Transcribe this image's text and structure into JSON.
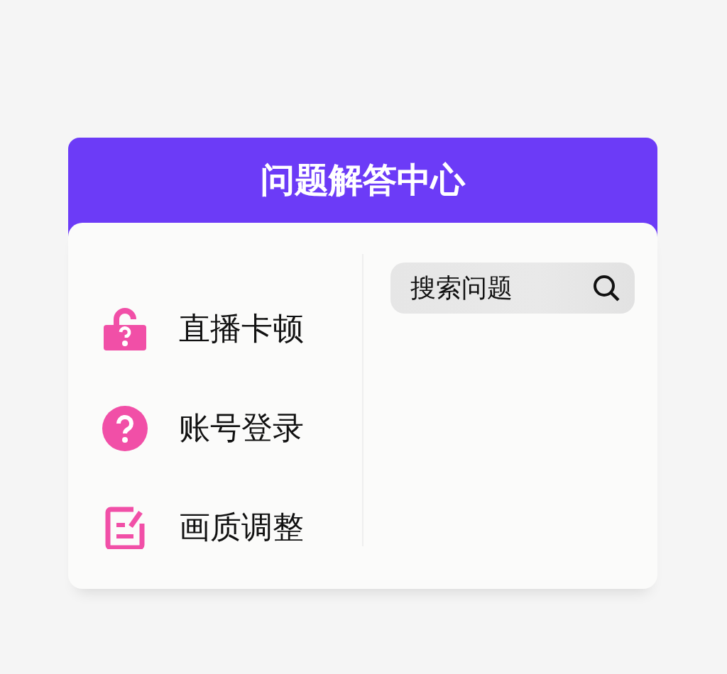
{
  "header": {
    "title": "问题解答中心"
  },
  "topics": [
    {
      "kind": "lock",
      "label": "直播卡顿"
    },
    {
      "kind": "question",
      "label": "账号登录"
    },
    {
      "kind": "edit",
      "label": "画质调整"
    }
  ],
  "search": {
    "placeholder": "搜索问题"
  }
}
